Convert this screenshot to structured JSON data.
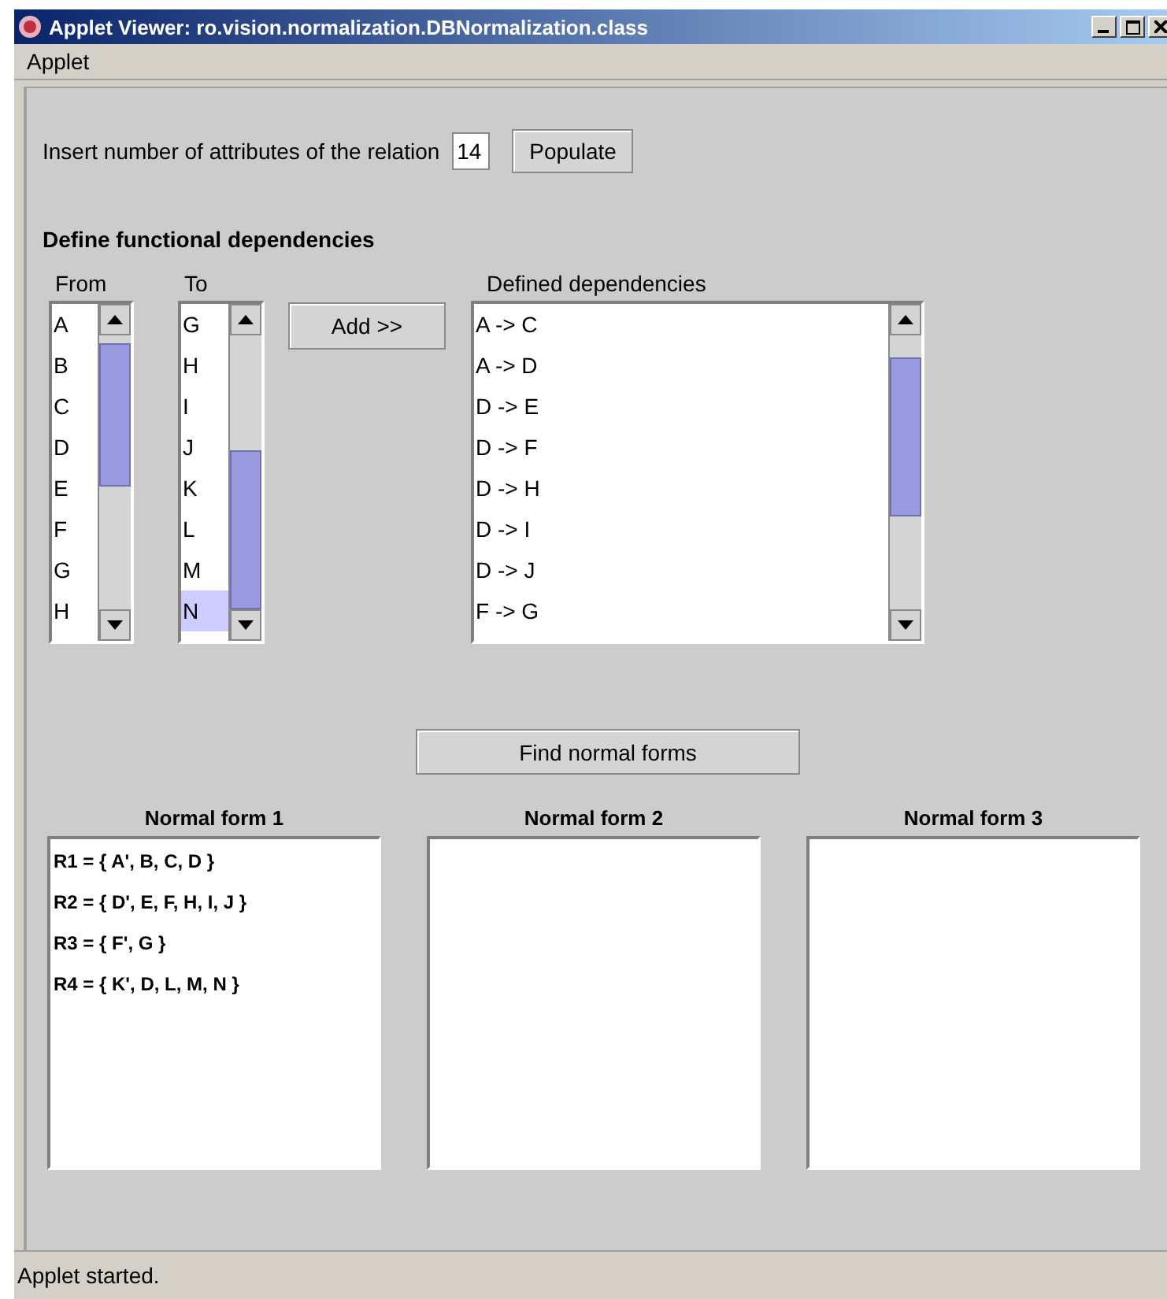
{
  "window": {
    "title": "Applet Viewer: ro.vision.normalization.DBNormalization.class"
  },
  "menu": [
    "Applet"
  ],
  "attributes": {
    "label": "Insert number of attributes of the relation",
    "value": "14",
    "button": "Populate"
  },
  "section_title": "Define functional dependencies",
  "from_list": {
    "label": "From",
    "items": [
      {
        "text": "A",
        "selected": false
      },
      {
        "text": "B",
        "selected": false
      },
      {
        "text": "C",
        "selected": false
      },
      {
        "text": "D",
        "selected": false
      },
      {
        "text": "E",
        "selected": false
      },
      {
        "text": "F",
        "selected": false
      },
      {
        "text": "G",
        "selected": false
      },
      {
        "text": "H",
        "selected": false
      }
    ]
  },
  "to_list": {
    "label": "To",
    "items": [
      {
        "text": "G",
        "selected": false
      },
      {
        "text": "H",
        "selected": false
      },
      {
        "text": "I",
        "selected": false
      },
      {
        "text": "J",
        "selected": false
      },
      {
        "text": "K",
        "selected": false
      },
      {
        "text": "L",
        "selected": false
      },
      {
        "text": "M",
        "selected": false
      },
      {
        "text": "N",
        "selected": true
      }
    ]
  },
  "add_button": "Add >>",
  "dependencies": {
    "label": "Defined dependencies",
    "items": [
      {
        "text": "A -> C",
        "selected": false
      },
      {
        "text": "A -> D",
        "selected": false
      },
      {
        "text": "D -> E",
        "selected": false
      },
      {
        "text": "D -> F",
        "selected": false
      },
      {
        "text": "D -> H",
        "selected": false
      },
      {
        "text": "D -> I",
        "selected": false
      },
      {
        "text": "D -> J",
        "selected": false
      },
      {
        "text": "F -> G",
        "selected": false
      }
    ]
  },
  "find_button": "Find normal forms",
  "normal_forms": [
    {
      "title": "Normal form 1",
      "lines": [
        "R1 = { A', B, C, D }",
        "R2 = { D', E, F, H, I, J }",
        "R3 = { F', G }",
        "R4 = { K', D, L, M, N }"
      ]
    },
    {
      "title": "Normal form 2"
    },
    {
      "title": "Normal form 3"
    }
  ],
  "status_bar": "Applet started."
}
